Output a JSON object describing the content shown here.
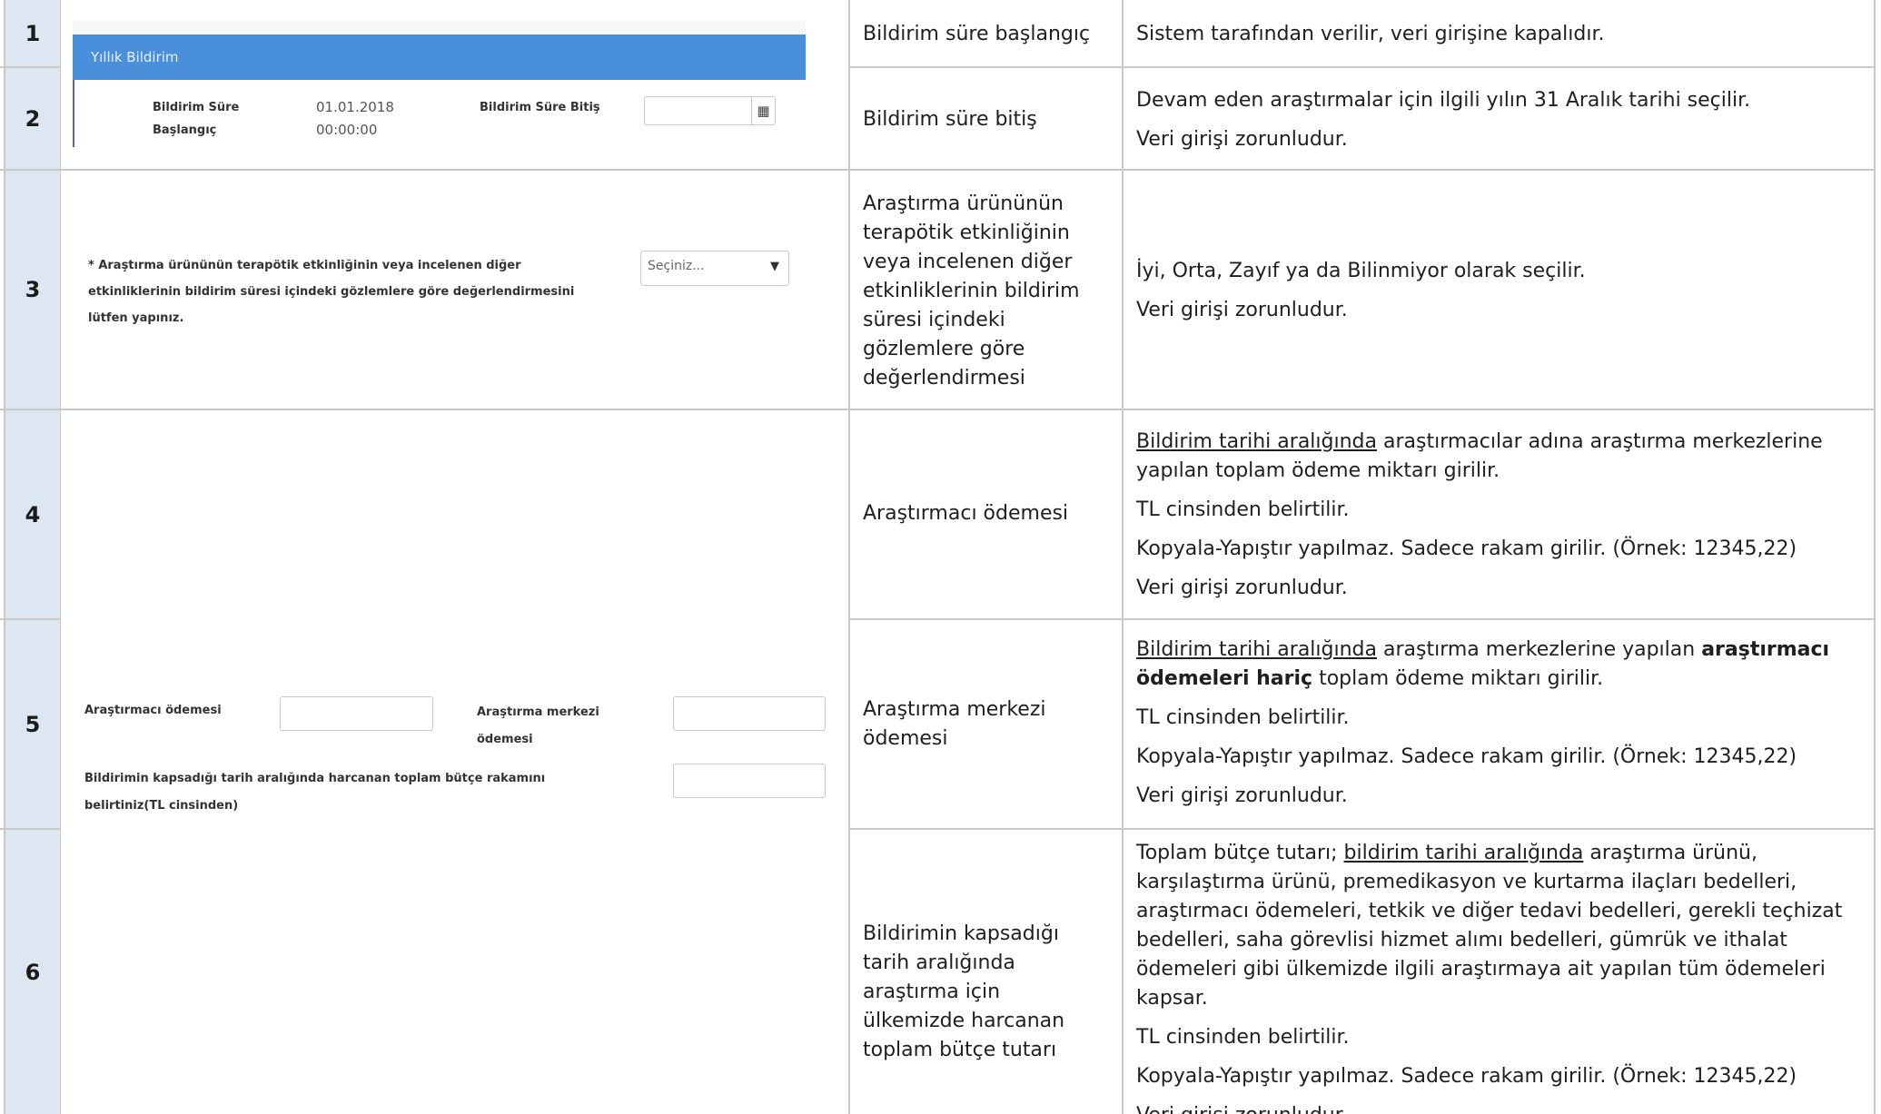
{
  "rows": [
    {
      "num": "1",
      "label": "Bildirim süre başlangıç",
      "desc": [
        "Sistem tarafından verilir, veri girişine kapalıdır."
      ]
    },
    {
      "num": "2",
      "label": "Bildirim süre bitiş",
      "desc": [
        "Devam eden araştırmalar için ilgili yılın 31 Aralık tarihi seçilir.",
        "Veri girişi zorunludur."
      ]
    },
    {
      "num": "3",
      "label": "Araştırma ürününün terapötik etkinliğinin veya incelenen diğer etkinliklerinin bildirim süresi içindeki gözlemlere göre değerlendirmesi",
      "desc": [
        "İyi, Orta, Zayıf ya da Bilinmiyor olarak seçilir.",
        "Veri girişi zorunludur."
      ]
    },
    {
      "num": "4",
      "label": "Araştırmacı ödemesi",
      "desc_underlined": "Bildirim tarihi aralığında",
      "desc_rest": " araştırmacılar adına araştırma merkezlerine yapılan toplam ödeme miktarı girilir.",
      "desc": [
        "TL cinsinden belirtilir.",
        "Kopyala-Yapıştır yapılmaz. Sadece rakam girilir. (Örnek: 12345,22)",
        "Veri girişi zorunludur."
      ]
    },
    {
      "num": "5",
      "label": "Araştırma merkezi ödemesi",
      "desc_underlined": "Bildirim tarihi aralığında",
      "desc_mid": " araştırma merkezlerine yapılan ",
      "desc_bold": "araştırmacı ödemeleri hariç",
      "desc_rest": " toplam ödeme miktarı girilir.",
      "desc": [
        "TL cinsinden belirtilir.",
        "Kopyala-Yapıştır yapılmaz. Sadece rakam girilir. (Örnek: 12345,22)",
        "Veri girişi zorunludur."
      ]
    },
    {
      "num": "6",
      "label": "Bildirimin kapsadığı tarih aralığında araştırma için ülkemizde harcanan toplam bütçe tutarı",
      "desc_pre": "Toplam bütçe tutarı; ",
      "desc_underlined": "bildirim tarihi aralığında",
      "desc_rest": " araştırma ürünü, karşılaştırma ürünü, premedikasyon ve kurtarma ilaçları bedelleri, araştırmacı ödemeleri, tetkik ve diğer tedavi bedelleri, gerekli teçhizat bedelleri, saha görevlisi hizmet alımı bedelleri, gümrük ve ithalat ödemeleri gibi ülkemizde ilgili araştırmaya ait yapılan tüm ödemeleri kapsar.",
      "desc": [
        "TL cinsinden belirtilir.",
        "Kopyala-Yapıştır yapılmaz. Sadece rakam girilir. (Örnek: 12345,22)",
        "Veri girişi zorunludur."
      ]
    }
  ],
  "form": {
    "panel_title": "Yıllık Bildirim",
    "start_label_1": "Bildirim Süre",
    "start_label_2": "Başlangıç",
    "start_value_1": "01.01.2018",
    "start_value_2": "00:00:00",
    "end_label": "Bildirim Süre Bitiş",
    "eval_label_1": "* Araştırma ürününün terapötik etkinliğinin veya incelenen diğer",
    "eval_label_2": "etkinliklerinin bildirim süresi içindeki gözlemlere göre değerlendirmesini",
    "eval_label_3": "lütfen yapınız.",
    "select_value": "Seçiniz...",
    "researcher_payment_label": "Araştırmacı ödemesi",
    "center_payment_label_1": "Araştırma merkezi",
    "center_payment_label_2": "ödemesi",
    "budget_label_1": "Bildirimin kapsadığı tarih aralığında harcanan toplam bütçe rakamını",
    "budget_label_2": "belirtiniz(TL cinsinden)"
  },
  "icons": {
    "calendar": "calendar-icon",
    "dropdown": "caret-down-icon"
  },
  "colors": {
    "number_column": "#dde7f1",
    "panel_header": "#4a8fd9",
    "grid_lines": "#c9c9c9"
  }
}
